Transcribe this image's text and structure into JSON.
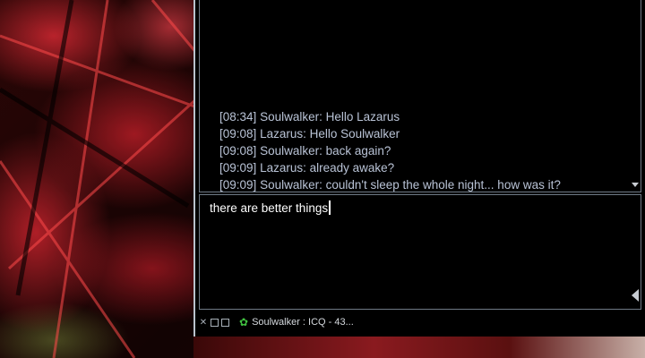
{
  "chat": {
    "messages": [
      {
        "time": "[08:34]",
        "sender": "Soulwalker:",
        "text": "Hello Lazarus"
      },
      {
        "time": "[09:08]",
        "sender": "Lazarus:",
        "text": "Hello Soulwalker"
      },
      {
        "time": "[09:08]",
        "sender": "Soulwalker:",
        "text": "back again?"
      },
      {
        "time": "[09:09]",
        "sender": "Lazarus:",
        "text": "already awake?"
      },
      {
        "time": "[09:09]",
        "sender": "Soulwalker:",
        "text": "couldn't sleep the whole night... how was it?"
      }
    ],
    "input_value": "there are better things"
  },
  "status_bar": {
    "label": "Soulwalker : ICQ - 43..."
  },
  "colors": {
    "window_bg": "#000000",
    "message_text": "#b9c3d6",
    "icq_flower": "#40c040"
  }
}
